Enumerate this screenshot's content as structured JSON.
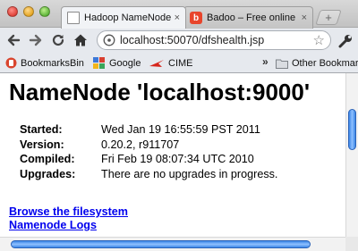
{
  "tabs": [
    {
      "label": "Hadoop NameNode lo",
      "close": "×"
    },
    {
      "label": "Badoo – Free online da",
      "close": "×",
      "favicon_letter": "b"
    }
  ],
  "newtab_label": "+",
  "toolbar": {
    "url": "localhost:50070/dfshealth.jsp"
  },
  "bookmarks": {
    "items": [
      {
        "label": "BookmarksBin"
      },
      {
        "label": "Google"
      },
      {
        "label": "CIME"
      }
    ],
    "overflow": "»",
    "other": "Other Bookmarks"
  },
  "page": {
    "title": "NameNode 'localhost:9000'",
    "info": [
      {
        "label": "Started:",
        "value": "Wed Jan 19 16:55:59 PST 2011"
      },
      {
        "label": "Version:",
        "value": "0.20.2, r911707"
      },
      {
        "label": "Compiled:",
        "value": "Fri Feb 19 08:07:34 UTC 2010"
      },
      {
        "label": "Upgrades:",
        "value": "There are no upgrades in progress."
      }
    ],
    "links": [
      {
        "label": "Browse the filesystem"
      },
      {
        "label": "Namenode Logs"
      }
    ]
  },
  "colors": {
    "link": "#0000ee",
    "scroll_thumb": "#3b86e6",
    "badoo": "#e8452c"
  }
}
